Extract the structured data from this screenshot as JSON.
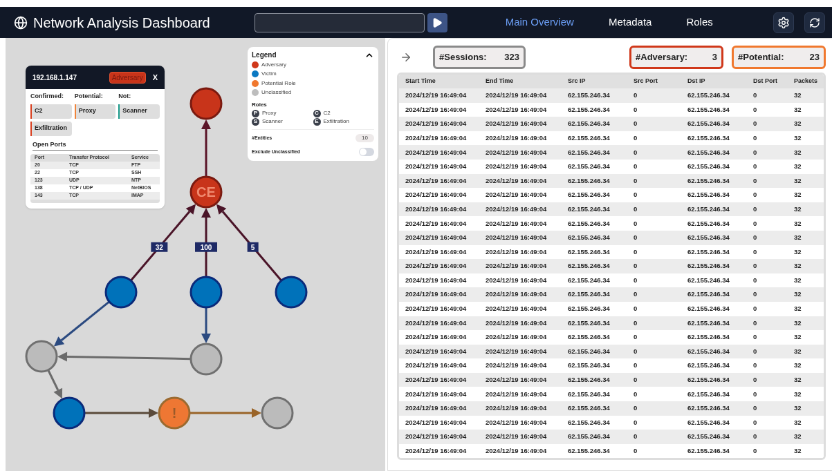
{
  "header": {
    "title": "Network Analysis Dashboard",
    "tabs": [
      {
        "label": "Main Overview",
        "selected": true
      },
      {
        "label": "Metadata",
        "selected": false
      },
      {
        "label": "Roles",
        "selected": false
      }
    ]
  },
  "graph": {
    "nodes": [
      {
        "kind": "adversary"
      },
      {
        "kind": "adversary",
        "label": "CE"
      },
      {
        "kind": "victim"
      },
      {
        "kind": "victim"
      },
      {
        "kind": "victim"
      },
      {
        "kind": "unclassified"
      },
      {
        "kind": "unclassified"
      },
      {
        "kind": "victim"
      },
      {
        "kind": "potential",
        "label": "!"
      },
      {
        "kind": "unclassified"
      }
    ],
    "edge_labels": [
      "32",
      "100",
      "5"
    ]
  },
  "node_card": {
    "ip": "192.168.1.147",
    "badge": "Adversary",
    "close": "X",
    "groups": [
      {
        "title": "Confirmed:",
        "color": "#d9401f",
        "tags": [
          "C2",
          "Exfiltration"
        ]
      },
      {
        "title": "Potential:",
        "color": "#f0843a",
        "tags": [
          "Proxy"
        ]
      },
      {
        "title": "Not:",
        "color": "#1a9a8a",
        "tags": [
          "Scanner"
        ]
      }
    ],
    "ports_title": "Open Ports",
    "ports_columns": [
      "Port",
      "Transfer Protocol",
      "Service"
    ],
    "ports": [
      [
        "20",
        "TCP",
        "FTP"
      ],
      [
        "22",
        "TCP",
        "SSH"
      ],
      [
        "123",
        "UDP",
        "NTP"
      ],
      [
        "138",
        "TCP / UDP",
        "NetBIOS"
      ],
      [
        "143",
        "TCP",
        "IMAP"
      ]
    ]
  },
  "legend": {
    "title": "Legend",
    "expanded": true,
    "items": [
      {
        "label": "Adversary",
        "color": "#d0381a"
      },
      {
        "label": "Victim",
        "color": "#0a78c2"
      },
      {
        "label": "Potential Role",
        "color": "#f0782e"
      },
      {
        "label": "Unclassified",
        "color": "#bdbdbd"
      }
    ],
    "roles_title": "Roles",
    "roles": [
      {
        "letter": "P",
        "label": "Proxy"
      },
      {
        "letter": "C",
        "label": "C2"
      },
      {
        "letter": "S",
        "label": "Scanner"
      },
      {
        "letter": "E",
        "label": "Exfiltration"
      }
    ],
    "entities_label": "#Entities",
    "entities": "10",
    "exclude_label": "Exclude Unclassified",
    "exclude_on": false
  },
  "stats": [
    {
      "label": "#Sessions:",
      "value": "323",
      "color": "#8a8a8a"
    },
    {
      "label": "#Adversary:",
      "value": "3",
      "color": "#d0381a"
    },
    {
      "label": "#Potential:",
      "value": "23",
      "color": "#f0782e"
    }
  ],
  "table": {
    "columns": [
      "Start Time",
      "End Time",
      "Src IP",
      "Src Port",
      "Dst IP",
      "Dst Port",
      "Packets"
    ],
    "rows": [
      [
        "2024/12/19 16:49:04",
        "2024/12/19 16:49:04",
        "62.155.246.34",
        "0",
        "62.155.246.34",
        "0",
        "32"
      ],
      [
        "2024/12/19 16:49:04",
        "2024/12/19 16:49:04",
        "62.155.246.34",
        "0",
        "62.155.246.34",
        "0",
        "32"
      ],
      [
        "2024/12/19 16:49:04",
        "2024/12/19 16:49:04",
        "62.155.246.34",
        "0",
        "62.155.246.34",
        "0",
        "32"
      ],
      [
        "2024/12/19 16:49:04",
        "2024/12/19 16:49:04",
        "62.155.246.34",
        "0",
        "62.155.246.34",
        "0",
        "32"
      ],
      [
        "2024/12/19 16:49:04",
        "2024/12/19 16:49:04",
        "62.155.246.34",
        "0",
        "62.155.246.34",
        "0",
        "32"
      ],
      [
        "2024/12/19 16:49:04",
        "2024/12/19 16:49:04",
        "62.155.246.34",
        "0",
        "62.155.246.34",
        "0",
        "32"
      ],
      [
        "2024/12/19 16:49:04",
        "2024/12/19 16:49:04",
        "62.155.246.34",
        "0",
        "62.155.246.34",
        "0",
        "32"
      ],
      [
        "2024/12/19 16:49:04",
        "2024/12/19 16:49:04",
        "62.155.246.34",
        "0",
        "62.155.246.34",
        "0",
        "32"
      ],
      [
        "2024/12/19 16:49:04",
        "2024/12/19 16:49:04",
        "62.155.246.34",
        "0",
        "62.155.246.34",
        "0",
        "32"
      ],
      [
        "2024/12/19 16:49:04",
        "2024/12/19 16:49:04",
        "62.155.246.34",
        "0",
        "62.155.246.34",
        "0",
        "32"
      ],
      [
        "2024/12/19 16:49:04",
        "2024/12/19 16:49:04",
        "62.155.246.34",
        "0",
        "62.155.246.34",
        "0",
        "32"
      ],
      [
        "2024/12/19 16:49:04",
        "2024/12/19 16:49:04",
        "62.155.246.34",
        "0",
        "62.155.246.34",
        "0",
        "32"
      ],
      [
        "2024/12/19 16:49:04",
        "2024/12/19 16:49:04",
        "62.155.246.34",
        "0",
        "62.155.246.34",
        "0",
        "32"
      ],
      [
        "2024/12/19 16:49:04",
        "2024/12/19 16:49:04",
        "62.155.246.34",
        "0",
        "62.155.246.34",
        "0",
        "32"
      ],
      [
        "2024/12/19 16:49:04",
        "2024/12/19 16:49:04",
        "62.155.246.34",
        "0",
        "62.155.246.34",
        "0",
        "32"
      ],
      [
        "2024/12/19 16:49:04",
        "2024/12/19 16:49:04",
        "62.155.246.34",
        "0",
        "62.155.246.34",
        "0",
        "32"
      ],
      [
        "2024/12/19 16:49:04",
        "2024/12/19 16:49:04",
        "62.155.246.34",
        "0",
        "62.155.246.34",
        "0",
        "32"
      ],
      [
        "2024/12/19 16:49:04",
        "2024/12/19 16:49:04",
        "62.155.246.34",
        "0",
        "62.155.246.34",
        "0",
        "32"
      ],
      [
        "2024/12/19 16:49:04",
        "2024/12/19 16:49:04",
        "62.155.246.34",
        "0",
        "62.155.246.34",
        "0",
        "32"
      ],
      [
        "2024/12/19 16:49:04",
        "2024/12/19 16:49:04",
        "62.155.246.34",
        "0",
        "62.155.246.34",
        "0",
        "32"
      ],
      [
        "2024/12/19 16:49:04",
        "2024/12/19 16:49:04",
        "62.155.246.34",
        "0",
        "62.155.246.34",
        "0",
        "32"
      ],
      [
        "2024/12/19 16:49:04",
        "2024/12/19 16:49:04",
        "62.155.246.34",
        "0",
        "62.155.246.34",
        "0",
        "32"
      ],
      [
        "2024/12/19 16:49:04",
        "2024/12/19 16:49:04",
        "62.155.246.34",
        "0",
        "62.155.246.34",
        "0",
        "32"
      ],
      [
        "2024/12/19 16:49:04",
        "2024/12/19 16:49:04",
        "62.155.246.34",
        "0",
        "62.155.246.34",
        "0",
        "32"
      ],
      [
        "2024/12/19 16:49:04",
        "2024/12/19 16:49:04",
        "62.155.246.34",
        "0",
        "62.155.246.34",
        "0",
        "32"
      ],
      [
        "2024/12/19 16:49:04",
        "2024/12/19 16:49:04",
        "62.155.246.34",
        "0",
        "62.155.246.34",
        "0",
        "32"
      ]
    ]
  }
}
